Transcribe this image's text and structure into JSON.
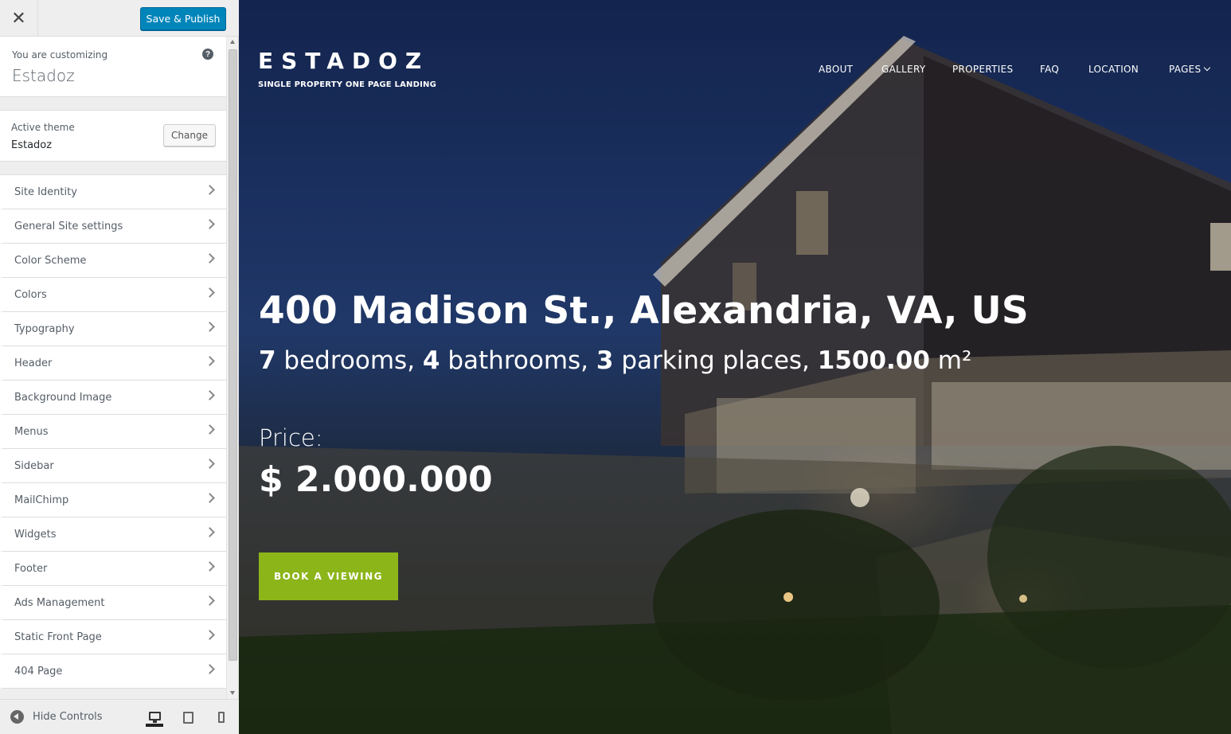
{
  "customizer": {
    "close_icon": "close-icon",
    "save_label": "Save & Publish",
    "customizing_label": "You are customizing",
    "site_name": "Estadoz",
    "active_theme_label": "Active theme",
    "active_theme_name": "Estadoz",
    "change_label": "Change",
    "sections": [
      {
        "label": "Site Identity"
      },
      {
        "label": "General Site settings"
      },
      {
        "label": "Color Scheme"
      },
      {
        "label": "Colors"
      },
      {
        "label": "Typography"
      },
      {
        "label": "Header"
      },
      {
        "label": "Background Image"
      },
      {
        "label": "Menus"
      },
      {
        "label": "Sidebar"
      },
      {
        "label": "MailChimp"
      },
      {
        "label": "Widgets"
      },
      {
        "label": "Footer"
      },
      {
        "label": "Ads Management"
      },
      {
        "label": "Static Front Page"
      },
      {
        "label": "404 Page"
      }
    ],
    "hide_controls_label": "Hide Controls",
    "devices": [
      "desktop",
      "tablet",
      "mobile"
    ],
    "active_device": "desktop",
    "accent": "#0085ba"
  },
  "site": {
    "logo": "ESTADOZ",
    "tagline": "SINGLE PROPERTY ONE PAGE LANDING",
    "nav": [
      {
        "label": "ABOUT"
      },
      {
        "label": "GALLERY"
      },
      {
        "label": "PROPERTIES"
      },
      {
        "label": "FAQ"
      },
      {
        "label": "LOCATION"
      },
      {
        "label": "PAGES"
      }
    ],
    "address": "400 Madison St., Alexandria, VA, US",
    "features": {
      "bedrooms_count": "7",
      "bedrooms_label": " bedrooms, ",
      "bathrooms_count": "4",
      "bathrooms_label": " bathrooms, ",
      "parking_count": "3",
      "parking_label": " parking places, ",
      "area_value": "1500.00",
      "area_unit": " m²"
    },
    "price_label": "Price:",
    "price_value": "$ 2.000.000",
    "cta_label": "BOOK A VIEWING",
    "cta_color": "#8cb51a"
  }
}
